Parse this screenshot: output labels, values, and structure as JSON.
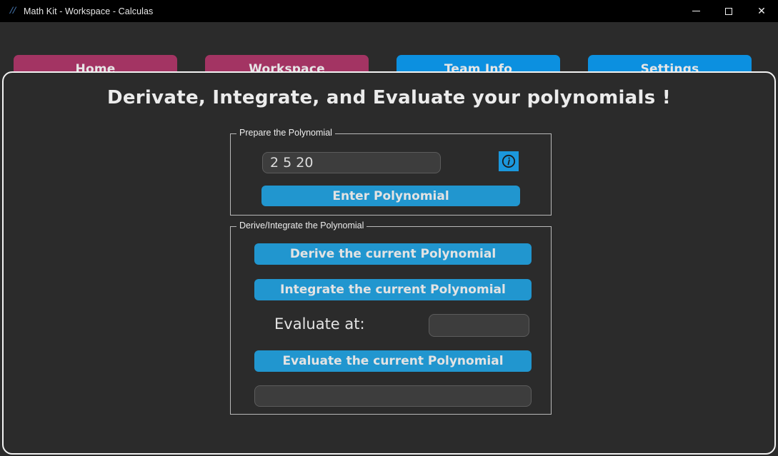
{
  "window": {
    "title": "Math Kit - Workspace - Calculas",
    "icon": "feather-icon",
    "controls": {
      "minimize": "minimize-icon",
      "maximize": "maximize-icon",
      "close": "close-icon"
    }
  },
  "nav": {
    "items": [
      {
        "label": "Home",
        "color": "#a33463"
      },
      {
        "label": "Workspace",
        "color": "#a33463"
      },
      {
        "label": "Team Info",
        "color": "#0c90e0"
      },
      {
        "label": "Settings",
        "color": "#0c90e0"
      }
    ]
  },
  "main": {
    "heading": "Derivate, Integrate, and Evaluate your polynomials !",
    "prepare_group": {
      "title": "Prepare the Polynomial",
      "polynomial_input": {
        "value": "2 5 20",
        "placeholder": ""
      },
      "info_button": {
        "icon": "info-circle-icon",
        "label": "i"
      },
      "enter_button": "Enter Polynomial"
    },
    "derive_group": {
      "title": "Derive/Integrate the Polynomial",
      "derive_button": "Derive the current Polynomial",
      "integrate_button": "Integrate the current Polynomial",
      "evaluate_label": "Evaluate at:",
      "evaluate_input": {
        "value": "",
        "placeholder": ""
      },
      "evaluate_button": "Evaluate the current Polynomial",
      "result_field": {
        "value": "",
        "placeholder": ""
      }
    }
  },
  "colors": {
    "background": "#2b2b2b",
    "titlebar": "#000000",
    "accent_blue": "#0c90e0",
    "accent_magenta": "#a33463",
    "button_blue": "#2196cf",
    "panel_border": "#f2f2f2",
    "field_bg": "#3d3d3d"
  }
}
